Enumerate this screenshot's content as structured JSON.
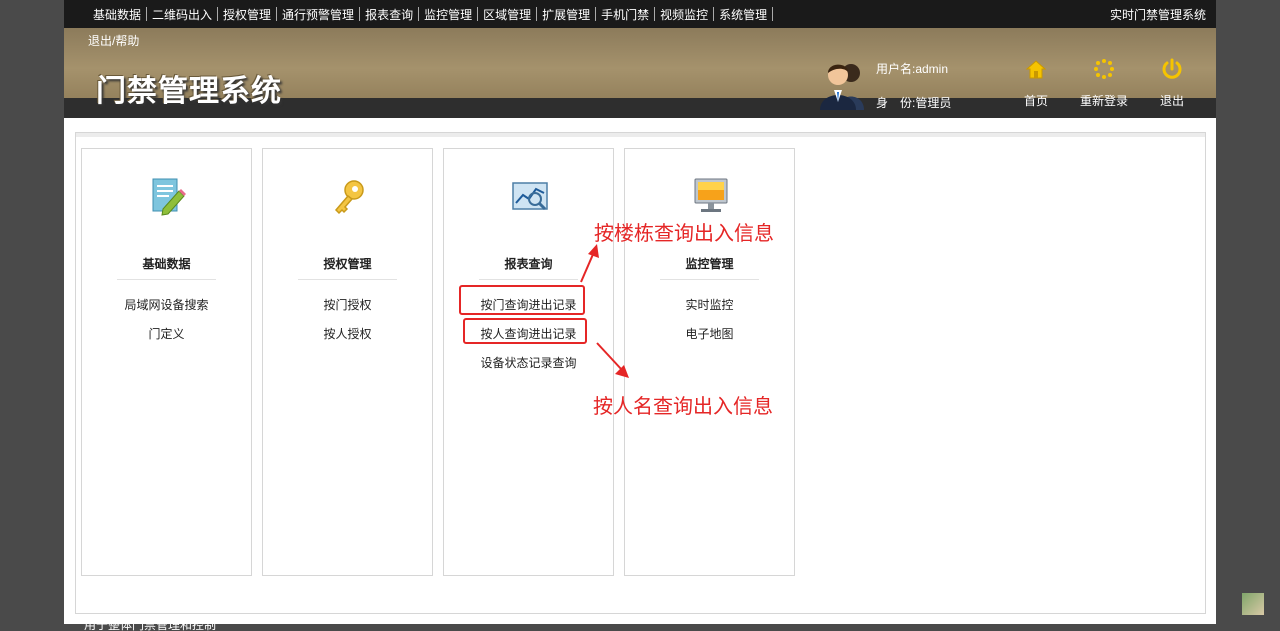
{
  "topnav": {
    "items": [
      "基础数据",
      "二维码出入",
      "授权管理",
      "通行预警管理",
      "报表查询",
      "监控管理",
      "区域管理",
      "扩展管理",
      "手机门禁",
      "视频监控",
      "系统管理"
    ],
    "right_title": "实时门禁管理系统"
  },
  "header": {
    "help": "退出/帮助",
    "title": "门禁管理系统",
    "user_name": "用户名:admin",
    "user_role": "身　份:管理员",
    "home": "首页",
    "relogin": "重新登录",
    "logout": "退出"
  },
  "cards": [
    {
      "title": "基础数据",
      "icon": "edit-document-icon",
      "links": [
        "局域网设备搜索",
        "门定义"
      ]
    },
    {
      "title": "授权管理",
      "icon": "key-icon",
      "links": [
        "按门授权",
        "按人授权"
      ]
    },
    {
      "title": "报表查询",
      "icon": "chart-icon",
      "links": [
        "按门查询进出记录",
        "按人查询进出记录",
        "设备状态记录查询"
      ]
    },
    {
      "title": "监控管理",
      "icon": "monitor-icon",
      "links": [
        "实时监控",
        "电子地图"
      ]
    }
  ],
  "annotations": {
    "building": "按楼栋查询出入信息",
    "person": "按人名查询出入信息"
  },
  "footer_text": "用于整体门禁管理和控制",
  "colors": {
    "annotation": "#e52626",
    "header_gold": "#a5926c",
    "accent_yellow": "#f5c400"
  }
}
